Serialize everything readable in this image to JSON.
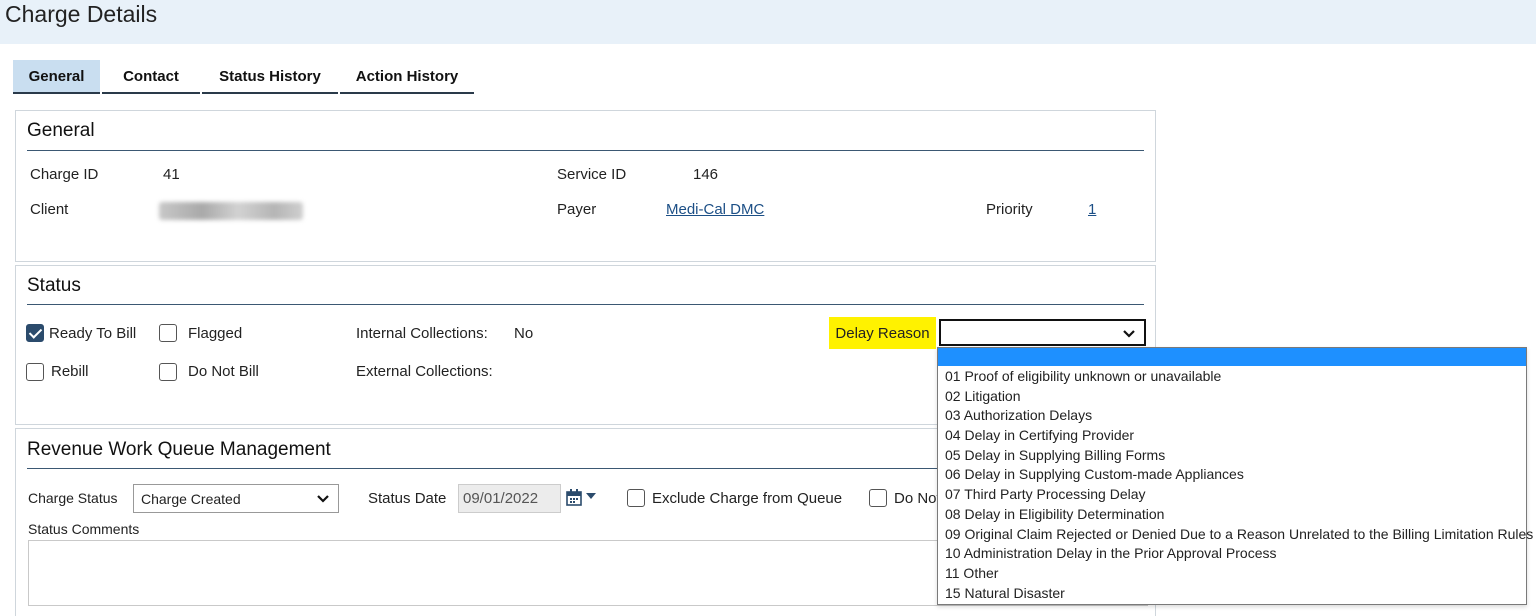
{
  "page": {
    "title": "Charge Details"
  },
  "tabs": [
    {
      "label": "General",
      "active": true
    },
    {
      "label": "Contact",
      "active": false
    },
    {
      "label": "Status History",
      "active": false
    },
    {
      "label": "Action History",
      "active": false
    }
  ],
  "general": {
    "title": "General",
    "charge_id_label": "Charge ID",
    "charge_id": "41",
    "service_id_label": "Service ID",
    "service_id": "146",
    "client_label": "Client",
    "payer_label": "Payer",
    "payer": "Medi-Cal DMC",
    "priority_label": "Priority",
    "priority": "1"
  },
  "status": {
    "title": "Status",
    "ready_to_bill": {
      "label": "Ready To Bill",
      "checked": true
    },
    "flagged": {
      "label": "Flagged",
      "checked": false
    },
    "rebill": {
      "label": "Rebill",
      "checked": false
    },
    "do_not_bill": {
      "label": "Do Not Bill",
      "checked": false
    },
    "internal_collections_label": "Internal Collections:",
    "internal_collections": "No",
    "external_collections_label": "External Collections:",
    "delay_reason_label": "Delay Reason",
    "delay_reason_value": "",
    "highlight_color": "#fff200"
  },
  "delay_reason_options": [
    "",
    "01 Proof of eligibility unknown or unavailable",
    "02 Litigation",
    "03 Authorization Delays",
    "04 Delay in Certifying Provider",
    "05 Delay in Supplying Billing Forms",
    "06 Delay in Supplying Custom-made Appliances",
    "07 Third Party Processing Delay",
    "08 Delay in Eligibility Determination",
    "09 Original Claim Rejected or Denied Due to a Reason Unrelated to the Billing Limitation Rules",
    "10 Administration Delay in the Prior Approval Process",
    "11 Other",
    "15 Natural Disaster"
  ],
  "revenue": {
    "title": "Revenue Work Queue Management",
    "charge_status_label": "Charge Status",
    "charge_status_value": "Charge Created",
    "status_date_label": "Status Date",
    "status_date_value": "09/01/2022",
    "exclude_label": "Exclude Charge from Queue",
    "do_not_label": "Do Not",
    "status_comments_label": "Status Comments"
  },
  "icons": {
    "calendar": "calendar-icon",
    "dropdown": "chevron-down-icon"
  },
  "colors": {
    "header_bg": "#e8f1f9",
    "tab_active_bg": "#c9def0",
    "link": "#1c4f86",
    "selection": "#1e90ff"
  }
}
